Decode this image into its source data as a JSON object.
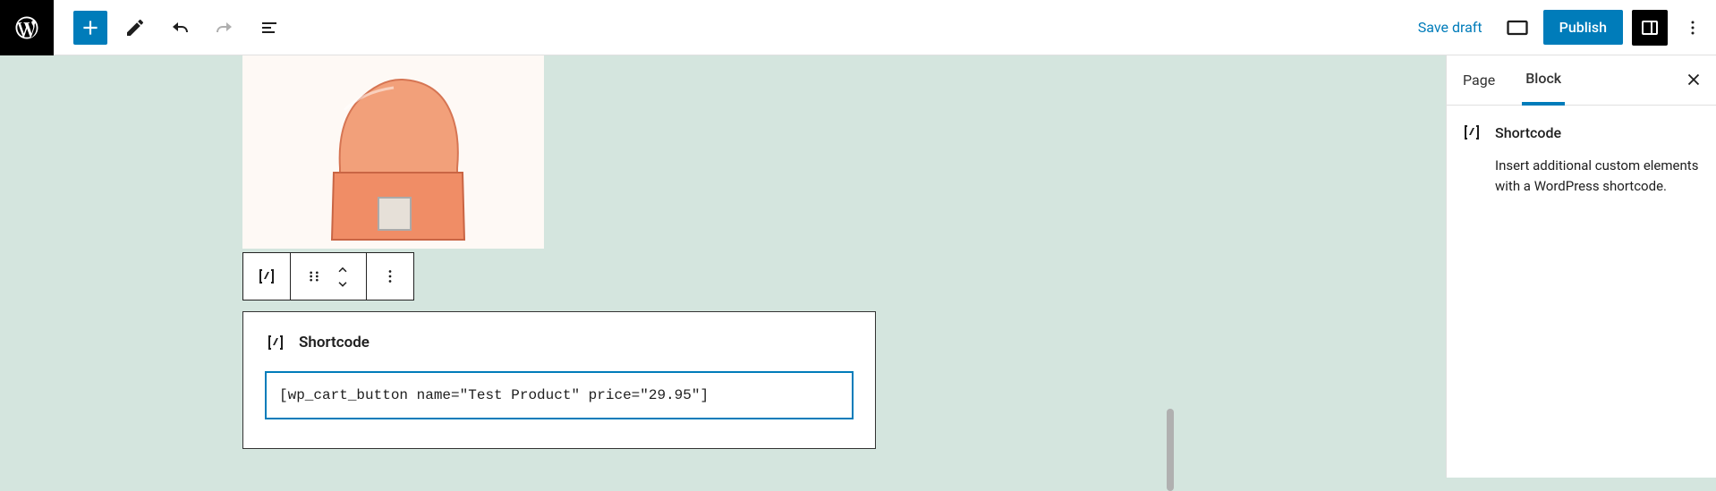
{
  "topbar": {
    "save_draft": "Save draft",
    "publish": "Publish"
  },
  "block_toolbar": {},
  "shortcode_block": {
    "label": "Shortcode",
    "value": "[wp_cart_button name=\"Test Product\" price=\"29.95\"]"
  },
  "sidebar": {
    "tabs": {
      "page": "Page",
      "block": "Block",
      "active": "block"
    },
    "card": {
      "title": "Shortcode",
      "description": "Insert additional custom elements with a WordPress shortcode."
    }
  }
}
